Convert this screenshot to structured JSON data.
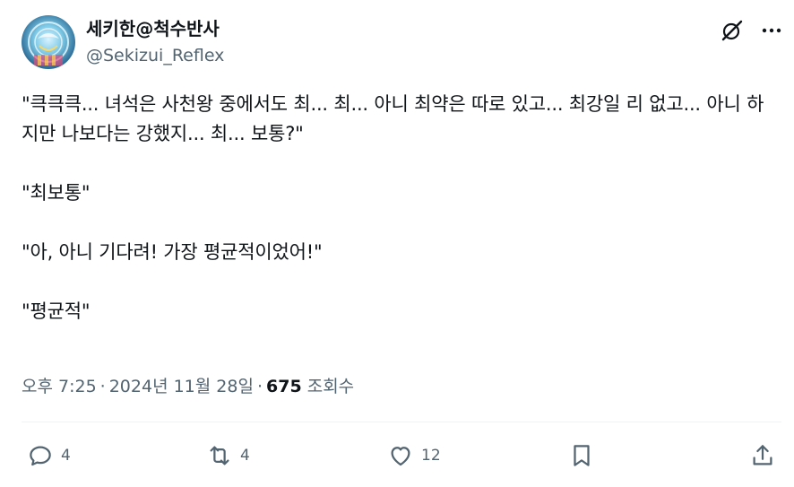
{
  "author": {
    "display_name": "세키한@척수반사",
    "handle": "@Sekizui_Reflex"
  },
  "tweet": {
    "paragraphs": [
      "\"큭큭큭... 녀석은 사천왕 중에서도 최... 최... 아니 최약은 따로 있고... 최강일 리 없고... 아니 하지만 나보다는 강했지... 최... 보통?\"",
      "\"최보통\"",
      "\"아, 아니 기다려! 가장 평균적이었어!\"",
      "\"평균적\""
    ],
    "time": "오후 7:25",
    "date": "2024년 11월 28일",
    "separator": "·",
    "views_count": "675",
    "views_label": "조회수"
  },
  "actions": {
    "reply_count": "4",
    "retweet_count": "4",
    "like_count": "12"
  },
  "icons": {
    "grok": "grok-icon",
    "more": "more-icon",
    "reply": "reply-icon",
    "retweet": "retweet-icon",
    "like": "heart-icon",
    "bookmark": "bookmark-icon",
    "share": "share-icon"
  },
  "colors": {
    "text": "#0f1419",
    "secondary": "#536471",
    "divider": "#eff3f4"
  }
}
